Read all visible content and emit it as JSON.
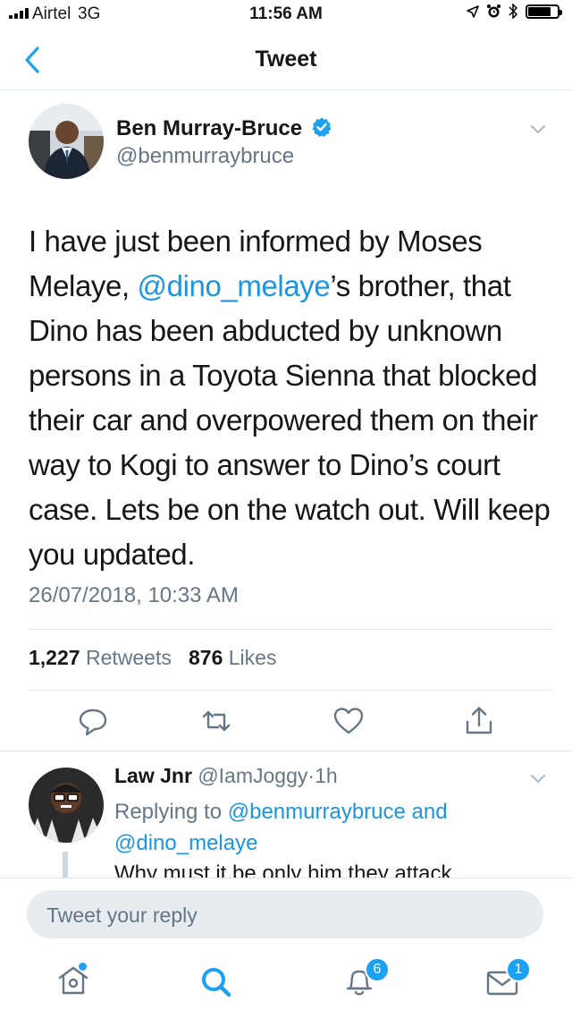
{
  "status_bar": {
    "carrier": "Airtel",
    "network": "3G",
    "time": "11:56 AM",
    "battery_level": 0.8
  },
  "nav": {
    "title": "Tweet"
  },
  "tweet": {
    "author_name": "Ben Murray-Bruce",
    "author_handle": "@benmurraybruce",
    "verified": true,
    "text_part1": "I have just been informed by Moses Melaye, ",
    "mention": "@dino_melaye",
    "text_part2": "’s brother, that Dino has been abducted by unknown persons in a Toyota Sienna that blocked their car and overpowered them on their way to Kogi to answer to Dino’s court case. Lets be on the watch out. Will keep you updated.",
    "timestamp": "26/07/2018, 10:33 AM",
    "retweets_count": "1,227",
    "retweets_label": "Retweets",
    "likes_count": "876",
    "likes_label": "Likes"
  },
  "reply": {
    "author_name": "Law Jnr",
    "author_handle": "@IamJoggy",
    "separator": "·",
    "time_ago": "1h",
    "replying_prefix": "Replying to ",
    "replying_user1": "@benmurraybruce",
    "replying_and": " and",
    "replying_user2": "@dino_melaye",
    "text": "Why must it be only him they attack"
  },
  "compose": {
    "placeholder": "Tweet your reply"
  },
  "tabbar": {
    "notifications_badge": "6",
    "messages_badge": "1"
  },
  "colors": {
    "accent": "#1da1f2",
    "link": "#1b95e0",
    "secondary_text": "#657786",
    "divider": "#e1e8ed"
  }
}
